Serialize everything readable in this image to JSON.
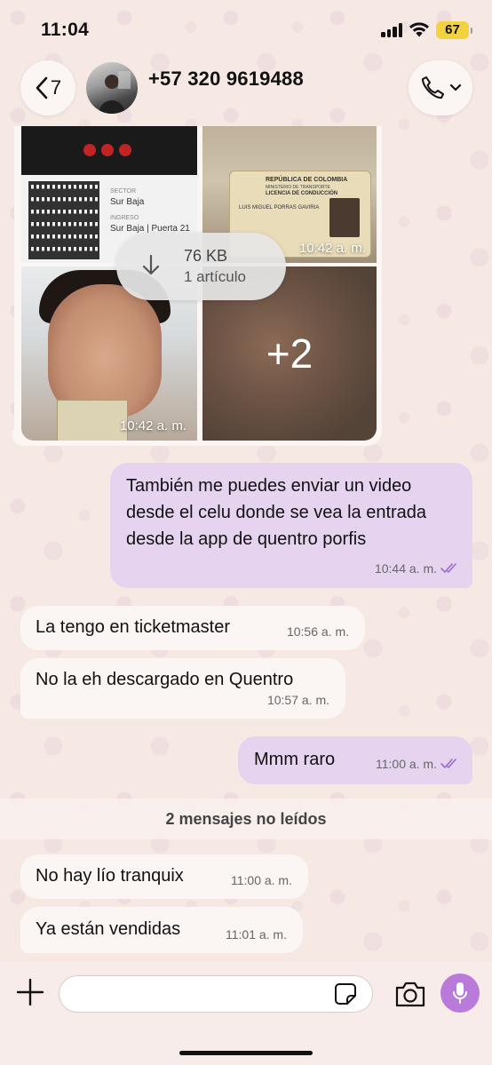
{
  "status_bar": {
    "time": "11:04",
    "battery": "67"
  },
  "header": {
    "back_count": "7",
    "contact": "+57 320 9619488"
  },
  "album": {
    "ticket": {
      "sector_label": "SECTOR",
      "sector_value": "Sur Baja",
      "entry_label": "INGRESO",
      "entry_value": "Sur Baja | Puerta 21"
    },
    "license": {
      "line1": "REPÚBLICA DE COLOMBIA",
      "line2": "MINISTERIO DE TRANSPORTE",
      "line3": "LICENCIA DE CONDUCCIÓN",
      "line4": "LUIS MIGUEL PORRAS GAVIRIA"
    },
    "time_top": "10:42 a. m.",
    "time_bottom": "10:42 a. m.",
    "more": "+2",
    "download_size": "76 KB",
    "download_items": "1 artículo"
  },
  "messages": [
    {
      "dir": "out",
      "text": "También me puedes enviar un video desde el celu donde se vea la entrada desde la app de quentro porfis",
      "time": "10:44 a. m."
    },
    {
      "dir": "in",
      "text": "La tengo en ticketmaster",
      "time": "10:56 a. m."
    },
    {
      "dir": "in",
      "text": "No la eh descargado en Quentro",
      "time": "10:57 a. m."
    },
    {
      "dir": "out",
      "text": "Mmm raro",
      "time": "11:00 a. m."
    },
    {
      "dir": "in",
      "text": "No hay lío tranquix",
      "time": "11:00 a. m."
    },
    {
      "dir": "in",
      "text": "Ya están vendidas",
      "time": "11:01 a. m."
    }
  ],
  "unread_banner": "2 mensajes no leídos",
  "composer": {
    "placeholder": ""
  },
  "colors": {
    "outgoing_bubble": "#e6d3f0",
    "incoming_bubble": "#fbf5f3",
    "accent": "#b97ad9",
    "read_ticks": "#9b6fc7"
  },
  "icons": [
    "back-chevron-icon",
    "phone-icon",
    "chevron-down-icon",
    "download-icon",
    "read-ticks-icon",
    "plus-icon",
    "sticker-icon",
    "camera-icon",
    "microphone-icon"
  ]
}
